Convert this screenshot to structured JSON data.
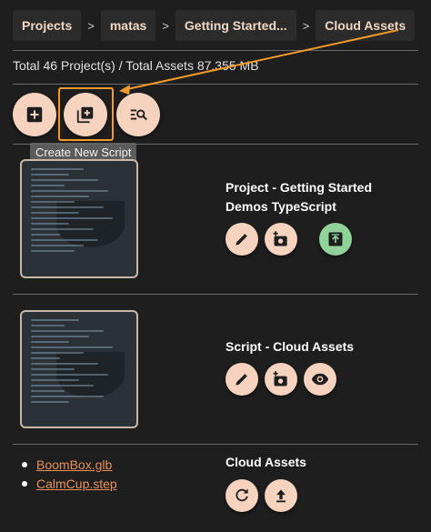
{
  "breadcrumb": {
    "items": [
      "Projects",
      "matas",
      "Getting Started...",
      "Cloud Assets"
    ],
    "separator": ">"
  },
  "totals": "Total 46 Project(s) / Total Assets 87.355 MB",
  "toolbar": {
    "add_project_icon": "add-box-icon",
    "new_script_icon": "library-add-icon",
    "search_icon": "manage-search-icon",
    "tooltip": "Create New Script",
    "accent_color": "#f29b2a"
  },
  "project": {
    "title": "Project - Getting Started Demos TypeScript",
    "actions": [
      "edit-icon",
      "add-photo-icon",
      "upload-icon"
    ]
  },
  "script": {
    "title": "Script - Cloud Assets",
    "actions": [
      "edit-icon",
      "add-photo-icon",
      "visibility-icon"
    ]
  },
  "cloud_assets": {
    "title": "Cloud Assets",
    "files": [
      "BoomBox.glb",
      "CalmCup.step"
    ],
    "actions": [
      "refresh-icon",
      "upload-icon"
    ]
  },
  "colors": {
    "background": "#1e1e1e",
    "button": "#f6d3bf",
    "button_green": "#8fd39b",
    "link": "#e9905b"
  }
}
